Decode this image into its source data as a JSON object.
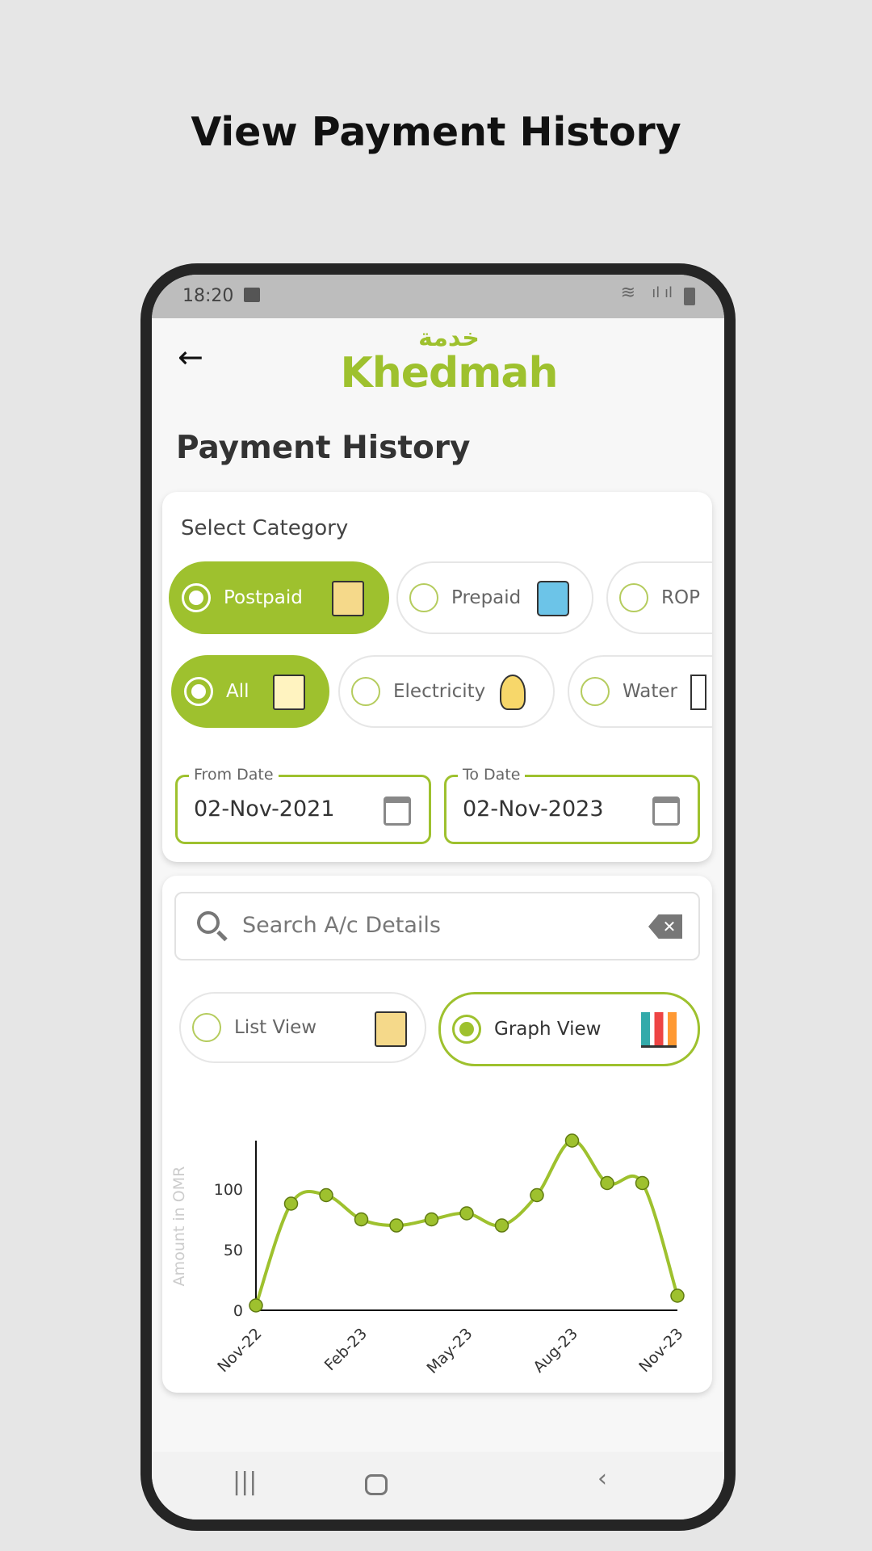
{
  "page_title": "View Payment History",
  "status_bar": {
    "time": "18:20"
  },
  "header": {
    "logo_text": "Khedmah",
    "logo_arabic": "خدمة",
    "heading": "Payment History"
  },
  "category": {
    "label": "Select Category",
    "types": [
      {
        "label": "Postpaid",
        "selected": true
      },
      {
        "label": "Prepaid",
        "selected": false
      },
      {
        "label": "ROP",
        "selected": false
      }
    ],
    "services": [
      {
        "label": "All",
        "selected": true
      },
      {
        "label": "Electricity",
        "selected": false
      },
      {
        "label": "Water",
        "selected": false
      }
    ]
  },
  "dates": {
    "from_label": "From Date",
    "from_value": "02-Nov-2021",
    "to_label": "To Date",
    "to_value": "02-Nov-2023"
  },
  "search": {
    "placeholder": "Search A/c Details"
  },
  "views": [
    {
      "label": "List View",
      "selected": false
    },
    {
      "label": "Graph View",
      "selected": true
    }
  ],
  "colors": {
    "accent": "#9ec12e"
  },
  "chart_data": {
    "type": "line",
    "ylabel": "Amount in OMR",
    "xlabel": "",
    "x": [
      "Nov-22",
      "Dec-22",
      "Jan-23",
      "Feb-23",
      "Mar-23",
      "Apr-23",
      "May-23",
      "Jun-23",
      "Jul-23",
      "Aug-23",
      "Sep-23",
      "Oct-23",
      "Nov-23"
    ],
    "x_tick_labels": [
      "Nov-22",
      "Feb-23",
      "May-23",
      "Aug-23",
      "Nov-23"
    ],
    "values": [
      4,
      88,
      95,
      75,
      70,
      75,
      80,
      70,
      95,
      140,
      105,
      105,
      12
    ],
    "y_ticks": [
      0,
      50,
      100
    ],
    "ylim": [
      0,
      140
    ],
    "grid": false
  }
}
